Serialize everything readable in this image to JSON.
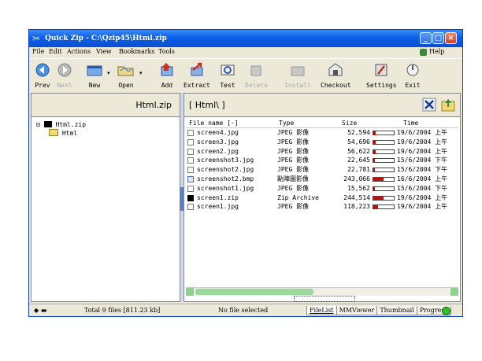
{
  "window": {
    "title": "Quick Zip - C:\\Qzip45\\Html.zip"
  },
  "menu": {
    "items": [
      "File",
      "Edit",
      "Actions",
      "View",
      "Bookmarks",
      "Tools"
    ],
    "help": "Help"
  },
  "toolbar": {
    "prev": "Prev",
    "next": "Next",
    "new": "New",
    "open": "Open",
    "add": "Add",
    "extract": "Extract",
    "test": "Test",
    "delete": "Delete",
    "install": "Install",
    "checkout": "Checkout",
    "settings": "Settings",
    "exit": "Exit"
  },
  "left_panel": {
    "title": "Html.zip",
    "tree": [
      {
        "label": "Html.zip",
        "expander": "⊟"
      },
      {
        "label": "Html"
      }
    ]
  },
  "right_panel": {
    "title": "[ Html\\ ]",
    "columns": {
      "name": "File name [-]",
      "type": "Type",
      "size": "Size",
      "time": "Time"
    },
    "files": [
      {
        "name": "screen4.jpg",
        "type": "JPEG 影像",
        "size": "52,594",
        "fraction": 0.12,
        "date": "19/6/2004 上午",
        "icon": "jpg"
      },
      {
        "name": "screen3.jpg",
        "type": "JPEG 影像",
        "size": "54,696",
        "fraction": 0.12,
        "date": "19/6/2004 上午",
        "icon": "jpg"
      },
      {
        "name": "screen2.jpg",
        "type": "JPEG 影像",
        "size": "56,622",
        "fraction": 0.12,
        "date": "19/6/2004 上午",
        "icon": "jpg"
      },
      {
        "name": "screenshot3.jpg",
        "type": "JPEG 影像",
        "size": "22,645",
        "fraction": 0.06,
        "date": "15/6/2004 下午",
        "icon": "jpg"
      },
      {
        "name": "screenshot2.jpg",
        "type": "JPEG 影像",
        "size": "22,781",
        "fraction": 0.06,
        "date": "15/6/2004 下午",
        "icon": "jpg"
      },
      {
        "name": "screenshot2.bmp",
        "type": "點陣圖影像",
        "size": "243,066",
        "fraction": 0.5,
        "date": "16/6/2004 上午",
        "icon": "bmp"
      },
      {
        "name": "screenshot1.jpg",
        "type": "JPEG 影像",
        "size": "15,562",
        "fraction": 0.04,
        "date": "15/6/2004 下午",
        "icon": "jpg"
      },
      {
        "name": "screen1.zip",
        "type": "Zip Archive",
        "size": "244,514",
        "fraction": 0.5,
        "date": "19/6/2004 上午",
        "icon": "zip"
      },
      {
        "name": "screen1.jpg",
        "type": "JPEG 影像",
        "size": "118,223",
        "fraction": 0.22,
        "date": "19/6/2004 上午",
        "icon": "jpg"
      }
    ]
  },
  "status": {
    "total": "Total 9 files [811.23 kb]",
    "selection": "No file selected",
    "tabs": [
      "FileList",
      "MMViewer",
      "Thumbnail",
      "Progress"
    ]
  },
  "colors": {
    "title_bar": "#0a5fe8",
    "size_bar": "#c01010",
    "status_led": "#2ec02e"
  }
}
